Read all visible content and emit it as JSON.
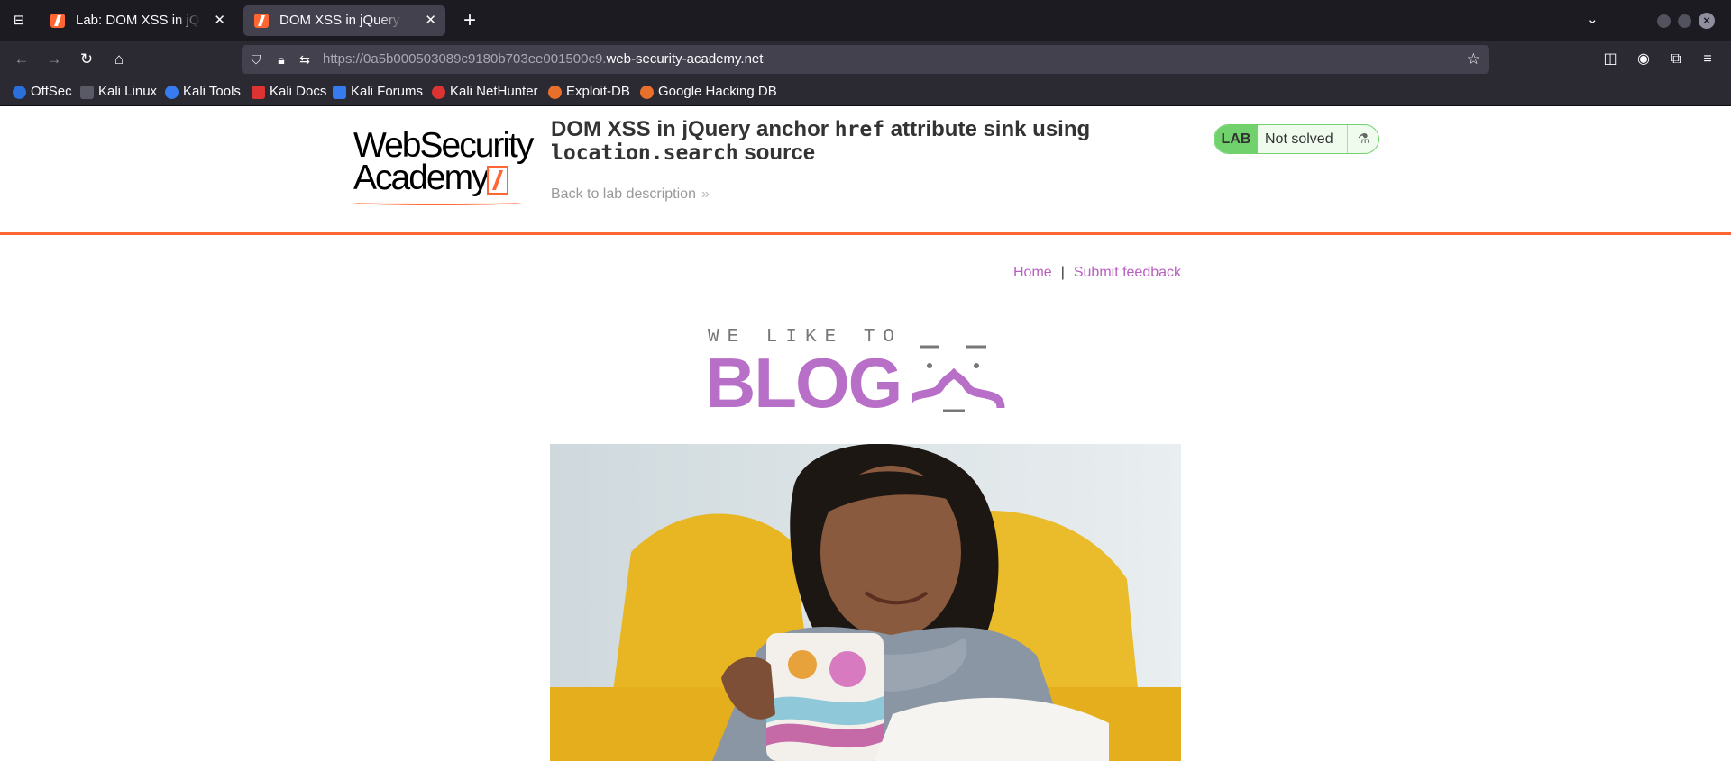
{
  "browser": {
    "tabs": [
      {
        "title": "Lab: DOM XSS in jQuery anchor",
        "active": false
      },
      {
        "title": "DOM XSS in jQuery anchor",
        "active": true
      }
    ],
    "url_prefix": "https://0a5b000503089c9180b703ee001500c9.",
    "url_domain": "web-security-academy.net",
    "bookmarks": [
      {
        "label": "OffSec",
        "color": "#2a6fdb"
      },
      {
        "label": "Kali Linux",
        "color": "#2b2a33"
      },
      {
        "label": "Kali Tools",
        "color": "#367bf0"
      },
      {
        "label": "Kali Docs",
        "color": "#d33"
      },
      {
        "label": "Kali Forums",
        "color": "#367bf0"
      },
      {
        "label": "Kali NetHunter",
        "color": "#d33"
      },
      {
        "label": "Exploit-DB",
        "color": "#e8702a"
      },
      {
        "label": "Google Hacking DB",
        "color": "#e8702a"
      }
    ]
  },
  "header": {
    "logo_line1": "WebSecurity",
    "logo_line2": "Academy",
    "title_part1": "DOM XSS in jQuery anchor ",
    "title_code1": "href",
    "title_part2": " attribute sink using ",
    "title_code2": "location.search",
    "title_part3": " source",
    "back_link": "Back to lab description",
    "lab_badge": "LAB",
    "lab_status": "Not solved"
  },
  "nav": {
    "home": "Home",
    "separator": "|",
    "feedback": "Submit feedback"
  },
  "blog_logo": {
    "tagline": "WE LIKE TO",
    "word": "BLOG"
  },
  "colors": {
    "accent": "#ff6633",
    "link": "#b85ec0",
    "lab_green": "#70d16d",
    "blog_purple": "#b86fc7"
  }
}
